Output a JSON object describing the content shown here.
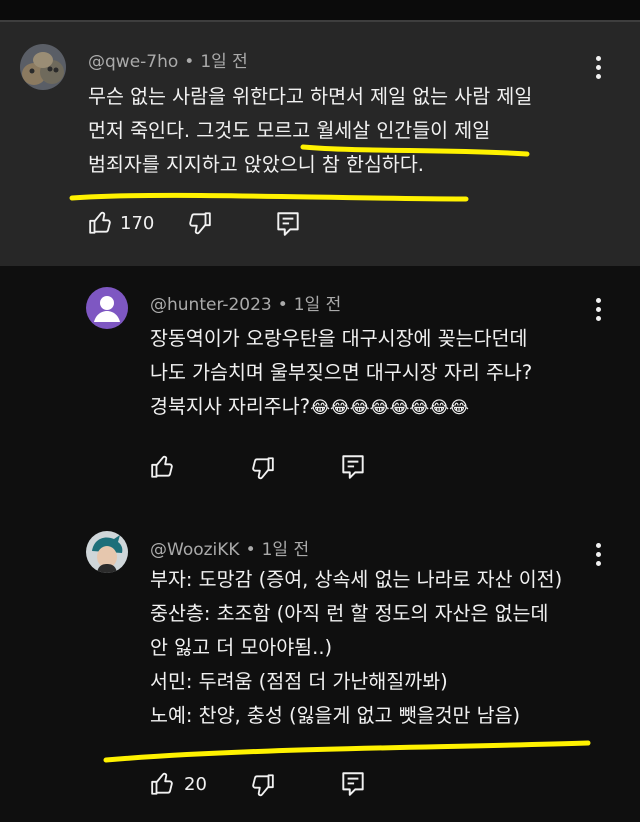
{
  "comments": [
    {
      "author": "@qwe-7ho",
      "time": "1일 전",
      "lines": [
        "무슨 없는 사람을 위한다고 하면서 제일 없는 사람 제일",
        "먼저 죽인다. 그것도 모르고 월세살 인간들이 제일",
        "범죄자를 지지하고 앉았으니 참 한심하다."
      ],
      "likes": "170"
    },
    {
      "author": "@hunter-2023",
      "time": "1일 전",
      "lines": [
        "장동역이가 오랑우탄을 대구시장에 꽂는다던데",
        "나도 가슴치며 울부짖으면 대구시장 자리 주나?",
        "경북지사 자리주나?"
      ],
      "emojis": "😂😂😂😂😂😂😂😂",
      "likes": ""
    },
    {
      "author": "@WooziKK",
      "time": "1일 전",
      "lines": [
        "부자: 도망감 (증여, 상속세 없는 나라로 자산 이전)",
        "중산층: 초조함 (아직 런 할 정도의 자산은 없는데",
        "안 잃고 더 모아야됨..)",
        "서민: 두려움 (점점 더 가난해질까봐)",
        "노예: 찬양, 충성 (잃을게 없고 뺏을것만 남음)"
      ],
      "likes": "20"
    }
  ],
  "colors": {
    "background": "#0f0f0f",
    "highlighted_comment_bg": "#272727",
    "meta_text": "#aaaaaa",
    "marker": "#fff200",
    "avatar_purple": "#7e57c2"
  },
  "icons": [
    "thumbs-up-icon",
    "thumbs-down-icon",
    "reply-icon",
    "more-vert-icon"
  ]
}
